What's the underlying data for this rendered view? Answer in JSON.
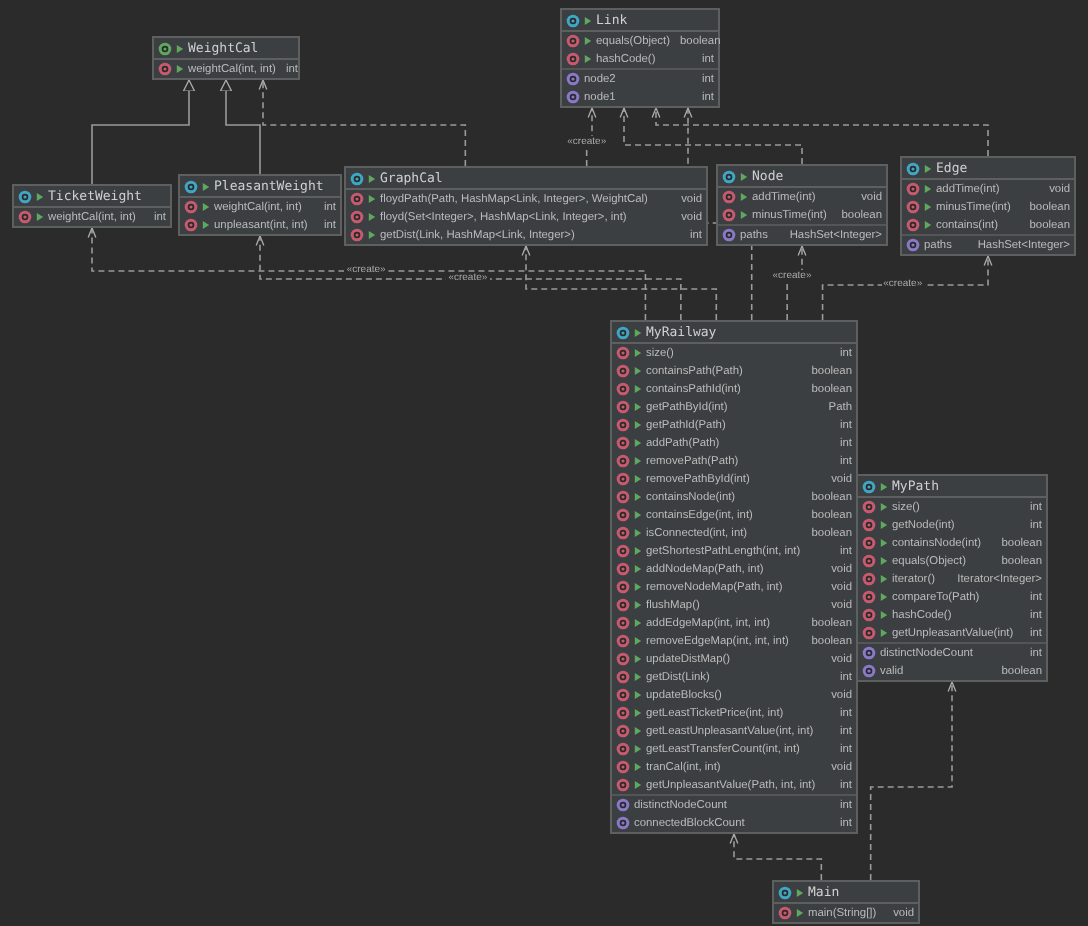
{
  "classes": [
    {
      "kind": "interface",
      "name": "WeightCal",
      "members": [
        {
          "kind": "method",
          "name": "weightCal(int, int)",
          "type": "int"
        }
      ]
    },
    {
      "kind": "class",
      "name": "Link",
      "members": [
        {
          "kind": "method",
          "name": "equals(Object)",
          "type": "boolean"
        },
        {
          "kind": "method",
          "name": "hashCode()",
          "type": "int"
        },
        {
          "kind": "field",
          "name": "node2",
          "type": "int"
        },
        {
          "kind": "field",
          "name": "node1",
          "type": "int"
        }
      ]
    },
    {
      "kind": "class",
      "name": "TicketWeight",
      "members": [
        {
          "kind": "method",
          "name": "weightCal(int, int)",
          "type": "int"
        }
      ]
    },
    {
      "kind": "class",
      "name": "PleasantWeight",
      "members": [
        {
          "kind": "method",
          "name": "weightCal(int, int)",
          "type": "int"
        },
        {
          "kind": "method",
          "name": "unpleasant(int, int)",
          "type": "int"
        }
      ]
    },
    {
      "kind": "class",
      "name": "GraphCal",
      "members": [
        {
          "kind": "method",
          "name": "floydPath(Path, HashMap<Link, Integer>, WeightCal)",
          "type": "void"
        },
        {
          "kind": "method",
          "name": "floyd(Set<Integer>, HashMap<Link, Integer>, int)",
          "type": "void"
        },
        {
          "kind": "method",
          "name": "getDist(Link, HashMap<Link, Integer>)",
          "type": "int"
        }
      ]
    },
    {
      "kind": "class",
      "name": "Node",
      "members": [
        {
          "kind": "method",
          "name": "addTime(int)",
          "type": "void"
        },
        {
          "kind": "method",
          "name": "minusTime(int)",
          "type": "boolean"
        },
        {
          "kind": "field",
          "name": "paths",
          "type": "HashSet<Integer>"
        }
      ]
    },
    {
      "kind": "class",
      "name": "Edge",
      "members": [
        {
          "kind": "method",
          "name": "addTime(int)",
          "type": "void"
        },
        {
          "kind": "method",
          "name": "minusTime(int)",
          "type": "boolean"
        },
        {
          "kind": "method",
          "name": "contains(int)",
          "type": "boolean"
        },
        {
          "kind": "field",
          "name": "paths",
          "type": "HashSet<Integer>"
        }
      ]
    },
    {
      "kind": "class",
      "name": "MyRailway",
      "members": [
        {
          "kind": "method",
          "name": "size()",
          "type": "int"
        },
        {
          "kind": "method",
          "name": "containsPath(Path)",
          "type": "boolean"
        },
        {
          "kind": "method",
          "name": "containsPathId(int)",
          "type": "boolean"
        },
        {
          "kind": "method",
          "name": "getPathById(int)",
          "type": "Path"
        },
        {
          "kind": "method",
          "name": "getPathId(Path)",
          "type": "int"
        },
        {
          "kind": "method",
          "name": "addPath(Path)",
          "type": "int"
        },
        {
          "kind": "method",
          "name": "removePath(Path)",
          "type": "int"
        },
        {
          "kind": "method",
          "name": "removePathById(int)",
          "type": "void"
        },
        {
          "kind": "method",
          "name": "containsNode(int)",
          "type": "boolean"
        },
        {
          "kind": "method",
          "name": "containsEdge(int, int)",
          "type": "boolean"
        },
        {
          "kind": "method",
          "name": "isConnected(int, int)",
          "type": "boolean"
        },
        {
          "kind": "method",
          "name": "getShortestPathLength(int, int)",
          "type": "int"
        },
        {
          "kind": "method",
          "name": "addNodeMap(Path, int)",
          "type": "void"
        },
        {
          "kind": "method",
          "name": "removeNodeMap(Path, int)",
          "type": "void"
        },
        {
          "kind": "method",
          "name": "flushMap()",
          "type": "void"
        },
        {
          "kind": "method",
          "name": "addEdgeMap(int, int, int)",
          "type": "boolean"
        },
        {
          "kind": "method",
          "name": "removeEdgeMap(int, int, int)",
          "type": "boolean"
        },
        {
          "kind": "method",
          "name": "updateDistMap()",
          "type": "void"
        },
        {
          "kind": "method",
          "name": "getDist(Link)",
          "type": "int"
        },
        {
          "kind": "method",
          "name": "updateBlocks()",
          "type": "void"
        },
        {
          "kind": "method",
          "name": "getLeastTicketPrice(int, int)",
          "type": "int"
        },
        {
          "kind": "method",
          "name": "getLeastUnpleasantValue(int, int)",
          "type": "int"
        },
        {
          "kind": "method",
          "name": "getLeastTransferCount(int, int)",
          "type": "int"
        },
        {
          "kind": "method",
          "name": "tranCal(int, int)",
          "type": "void"
        },
        {
          "kind": "method",
          "name": "getUnpleasantValue(Path, int, int)",
          "type": "int"
        },
        {
          "kind": "field",
          "name": "distinctNodeCount",
          "type": "int"
        },
        {
          "kind": "field",
          "name": "connectedBlockCount",
          "type": "int"
        }
      ]
    },
    {
      "kind": "class",
      "name": "MyPath",
      "members": [
        {
          "kind": "method",
          "name": "size()",
          "type": "int"
        },
        {
          "kind": "method",
          "name": "getNode(int)",
          "type": "int"
        },
        {
          "kind": "method",
          "name": "containsNode(int)",
          "type": "boolean"
        },
        {
          "kind": "method",
          "name": "equals(Object)",
          "type": "boolean"
        },
        {
          "kind": "method",
          "name": "iterator()",
          "type": "Iterator<Integer>"
        },
        {
          "kind": "method",
          "name": "compareTo(Path)",
          "type": "int"
        },
        {
          "kind": "method",
          "name": "hashCode()",
          "type": "int"
        },
        {
          "kind": "method",
          "name": "getUnpleasantValue(int)",
          "type": "int"
        },
        {
          "kind": "field",
          "name": "distinctNodeCount",
          "type": "int"
        },
        {
          "kind": "field",
          "name": "valid",
          "type": "boolean"
        }
      ]
    },
    {
      "kind": "class",
      "name": "Main",
      "members": [
        {
          "kind": "method",
          "name": "main(String[])",
          "type": "void"
        }
      ]
    }
  ],
  "relations": [
    {
      "kind": "realization"
    },
    {
      "kind": "realization"
    },
    {
      "kind": "dependency"
    },
    {
      "kind": "dependency",
      "label": "«create»"
    },
    {
      "kind": "dependency"
    },
    {
      "kind": "dependency"
    },
    {
      "kind": "dependency",
      "label": "«create»"
    },
    {
      "kind": "dependency",
      "label": "«create»"
    },
    {
      "kind": "dependency"
    },
    {
      "kind": "dependency"
    },
    {
      "kind": "dependency",
      "label": "«create»"
    },
    {
      "kind": "dependency",
      "label": "«create»"
    },
    {
      "kind": "dependency"
    },
    {
      "kind": "dependency"
    }
  ]
}
